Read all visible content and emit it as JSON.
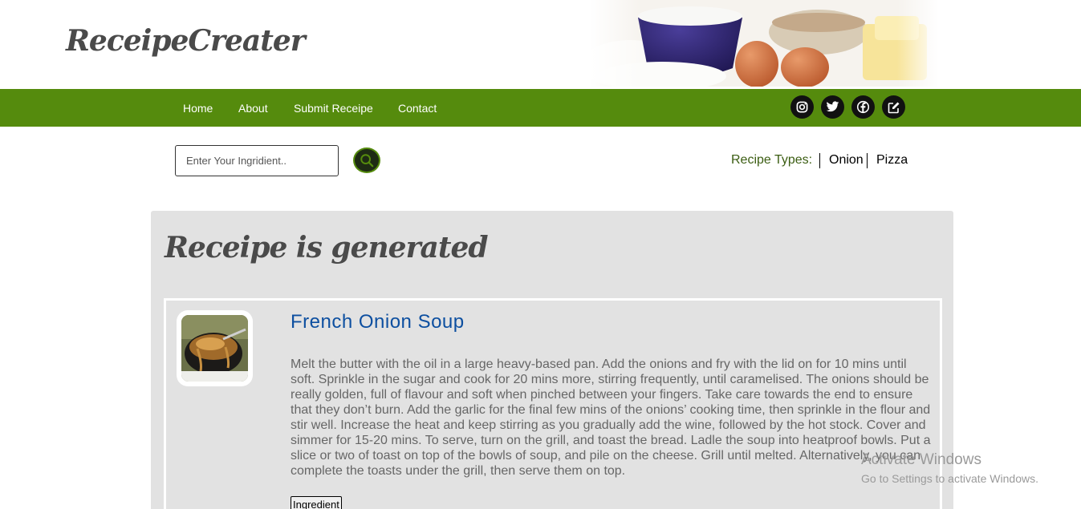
{
  "header": {
    "logo": "ReceipeCreater"
  },
  "nav": {
    "links": [
      "Home",
      "About",
      "Submit Receipe",
      "Contact"
    ],
    "social": [
      "instagram-icon",
      "twitter-icon",
      "facebook-icon",
      "edit-icon"
    ]
  },
  "search": {
    "placeholder": "Enter Your Ingridient..",
    "value": ""
  },
  "recipe_types": {
    "label": "Recipe Types:",
    "items": [
      "Onion",
      "Pizza"
    ]
  },
  "result": {
    "title": "Receipe is generated",
    "recipe": {
      "name": "French Onion Soup",
      "description": "Melt the butter with the oil in a large heavy-based pan. Add the onions and fry with the lid on for 10 mins until soft. Sprinkle in the sugar and cook for 20 mins more, stirring frequently, until caramelised. The onions should be really golden, full of flavour and soft when pinched between your fingers. Take care towards the end to ensure that they don’t burn. Add the garlic for the final few mins of the onions’ cooking time, then sprinkle in the flour and stir well. Increase the heat and keep stirring as you gradually add the wine, followed by the hot stock. Cover and simmer for 15-20 mins. To serve, turn on the grill, and toast the bread. Ladle the soup into heatproof bowls. Put a slice or two of toast on top of the bowls of soup, and pile on the cheese. Grill until melted. Alternatively, you can complete the toasts under the grill, then serve them on top.",
      "ingredient_button": "Ingredient"
    }
  },
  "watermark": {
    "title": "Activate Windows",
    "subtitle": "Go to Settings to activate Windows."
  },
  "colors": {
    "nav_green": "#558b0d",
    "title_blue": "#0d4fa0",
    "panel_gray": "#e2e2e2"
  }
}
